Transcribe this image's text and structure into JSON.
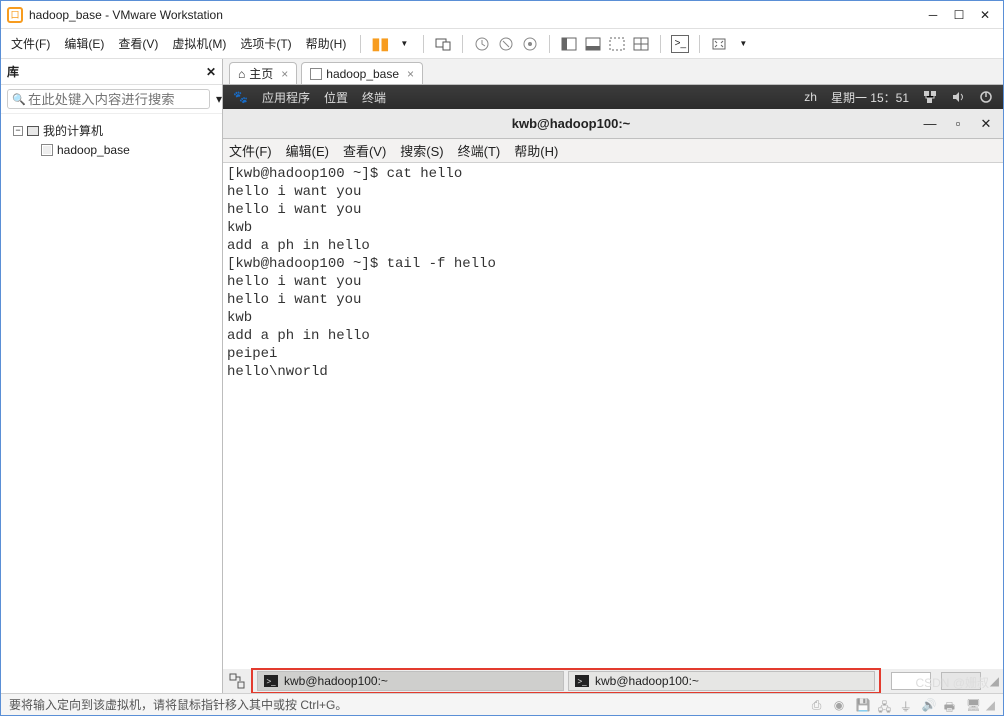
{
  "titlebar": {
    "title": "hadoop_base - VMware Workstation"
  },
  "menu": {
    "file": "文件(F)",
    "edit": "编辑(E)",
    "view": "查看(V)",
    "vm": "虚拟机(M)",
    "tabs": "选项卡(T)",
    "help": "帮助(H)"
  },
  "library": {
    "header": "库",
    "search_placeholder": "在此处键入内容进行搜索",
    "dropdown_glyph": "▾",
    "root": "我的计算机",
    "items": [
      "hadoop_base"
    ]
  },
  "tabs": {
    "home": {
      "label": "主页"
    },
    "vm": {
      "label": "hadoop_base"
    }
  },
  "gnome": {
    "foot_icon": "🐾",
    "apps": "应用程序",
    "places": "位置",
    "terminal": "终端",
    "lang": "zh",
    "clock": "星期一 15：51"
  },
  "terminal": {
    "title": "kwb@hadoop100:~",
    "menu": {
      "file": "文件(F)",
      "edit": "编辑(E)",
      "view": "查看(V)",
      "search": "搜索(S)",
      "term": "终端(T)",
      "help": "帮助(H)"
    },
    "content": "[kwb@hadoop100 ~]$ cat hello\nhello i want you\nhello i want you\nkwb\nadd a ph in hello\n[kwb@hadoop100 ~]$ tail -f hello\nhello i want you\nhello i want you\nkwb\nadd a ph in hello\npeipei\nhello\\nworld"
  },
  "taskbar": {
    "items": [
      {
        "label": "kwb@hadoop100:~",
        "active": true
      },
      {
        "label": "kwb@hadoop100:~",
        "active": false
      }
    ]
  },
  "statusbar": {
    "text": "要将输入定向到该虚拟机，请将鼠标指针移入其中或按 Ctrl+G。",
    "watermark": "CSDN @姗叔"
  }
}
